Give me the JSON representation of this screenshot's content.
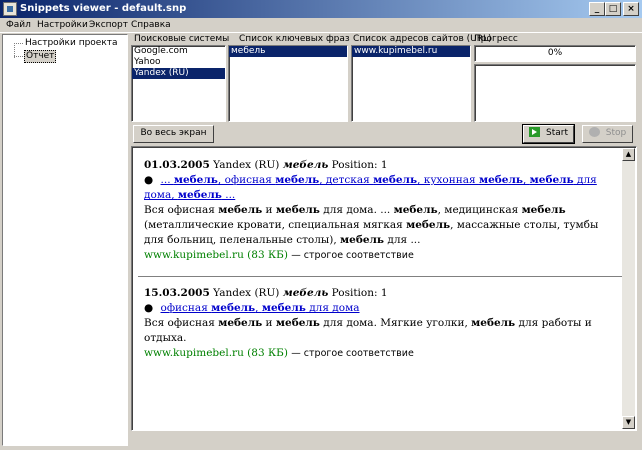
{
  "window": {
    "title": "Snippets viewer - default.snp",
    "buttons": [
      "minimize",
      "maximize",
      "close"
    ],
    "minimize_glyph": "_",
    "maximize_glyph": "□",
    "close_glyph": "×"
  },
  "menu": [
    "Файл",
    "Настройки",
    "Экспорт",
    "Справка"
  ],
  "tree": {
    "items": [
      "Настройки проекта",
      "Отчет"
    ],
    "selected": "Отчет"
  },
  "panels": {
    "search_engines": {
      "label": "Поисковые системы",
      "items": [
        "Google.com",
        "Yahoo",
        "Yandex (RU)"
      ],
      "selected": "Yandex (RU)"
    },
    "keywords": {
      "label": "Список ключевых фраз",
      "items": [
        "мебель"
      ],
      "selected": "мебель"
    },
    "urls": {
      "label": "Список адресов сайтов (URL)",
      "items": [
        "www.kupimebel.ru"
      ],
      "selected": "www.kupimebel.ru"
    },
    "progress": {
      "label": "Прогресс",
      "text": "0%",
      "value": 0
    }
  },
  "toolbar": {
    "fullscreen_label": "Во весь экран",
    "start_label": "Start",
    "stop_label": "Stop",
    "stop_enabled": false
  },
  "icons": {
    "start": "start-icon",
    "stop": "stop-icon",
    "scroll_up": "arrow-up-icon",
    "scroll_down": "arrow-down-icon"
  },
  "report": {
    "entries": [
      {
        "date": "01.03.2005",
        "engine": "Yandex (RU)",
        "keyword": "мебель",
        "position_text": "Position: 1",
        "snippet_html_link": "... <b>мебель</b>, офисная <b>мебель</b>, детская <b>мебель</b>, кухонная <b>мебель</b>, <b>мебель</b> для дома, <b>мебель</b> ...",
        "text_html": "Вся офисная <b>мебель</b> и <b>мебель</b> для дома. ... <b>мебель</b>, медицинская <b>мебель</b> (металлические кровати, специальная мягкая <b>мебель</b>, массажные столы, тумбы для больниц, пеленальные столы), <b>мебель</b> для ...",
        "site": "www.kupimebel.ru (83 КБ)",
        "match": "— строгое соответствие"
      },
      {
        "date": "15.03.2005",
        "engine": "Yandex (RU)",
        "keyword": "мебель",
        "position_text": "Position: 1",
        "snippet_html_link": "офисная <b>мебель</b>, <b>мебель</b> для дома",
        "text_html": "Вся офисная <b>мебель</b> и <b>мебель</b> для дома. Мягкие уголки, <b>мебель</b> для работы и отдыха.",
        "site": "www.kupimebel.ru (83 КБ)",
        "match": "— строгое соответствие"
      }
    ]
  },
  "colors": {
    "title_start": "#0a246a",
    "title_end": "#a6caf0",
    "selection": "#0a246a",
    "link": "#0000cc",
    "site": "#008000",
    "face": "#d4d0c8"
  }
}
